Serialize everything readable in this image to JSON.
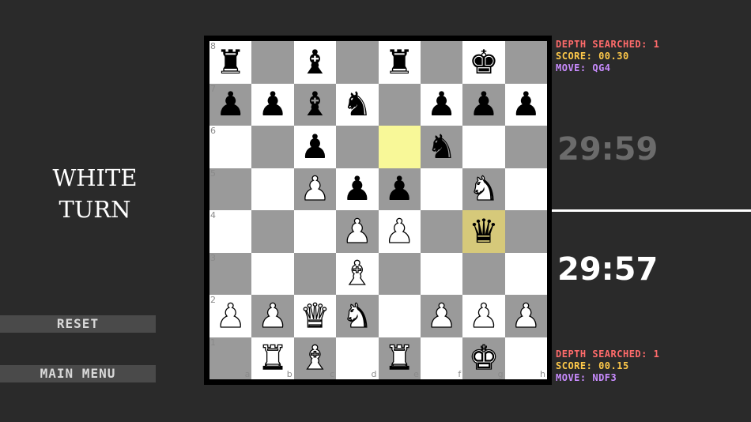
{
  "turn": {
    "line1": "WHITE",
    "line2": "TURN"
  },
  "buttons": {
    "reset": "RESET",
    "main_menu": "MAIN MENU"
  },
  "colors": {
    "light_square": "#ffffff",
    "dark_square": "#9a9a9a",
    "last_move_from": "#f8f898",
    "last_move_to": "#d6c97a"
  },
  "top_info": {
    "depth": "DEPTH SEARCHED: 1",
    "score": "SCORE: 00.30",
    "move": "MOVE: QG4"
  },
  "bottom_info": {
    "depth": "DEPTH SEARCHED: 1",
    "score": "SCORE: 00.15",
    "move": "MOVE: NDF3"
  },
  "timers": {
    "black": "29:59",
    "white": "29:57",
    "black_color": "#6b6b6b",
    "white_color": "#ffffff"
  },
  "files": [
    "a",
    "b",
    "c",
    "d",
    "e",
    "f",
    "g",
    "h"
  ],
  "ranks": [
    "8",
    "7",
    "6",
    "5",
    "4",
    "3",
    "2",
    "1"
  ],
  "board": [
    [
      "bR",
      "",
      "bB",
      "",
      "bR",
      "",
      "bK",
      ""
    ],
    [
      "bP",
      "bP",
      "bB",
      "bN",
      "",
      "bP",
      "bP",
      "bP"
    ],
    [
      "",
      "",
      "bP",
      "",
      "",
      "bN",
      "",
      ""
    ],
    [
      "",
      "",
      "wP",
      "bP",
      "bP",
      "",
      "wN",
      ""
    ],
    [
      "",
      "",
      "",
      "wP",
      "wP",
      "",
      "bQ",
      ""
    ],
    [
      "",
      "",
      "",
      "wB",
      "",
      "",
      "",
      ""
    ],
    [
      "wP",
      "wP",
      "wQ",
      "wN",
      "",
      "wP",
      "wP",
      "wP"
    ],
    [
      "",
      "wR",
      "wB",
      "",
      "wR",
      "",
      "wK",
      ""
    ]
  ],
  "highlights": {
    "from": "e6",
    "to": "g4"
  }
}
